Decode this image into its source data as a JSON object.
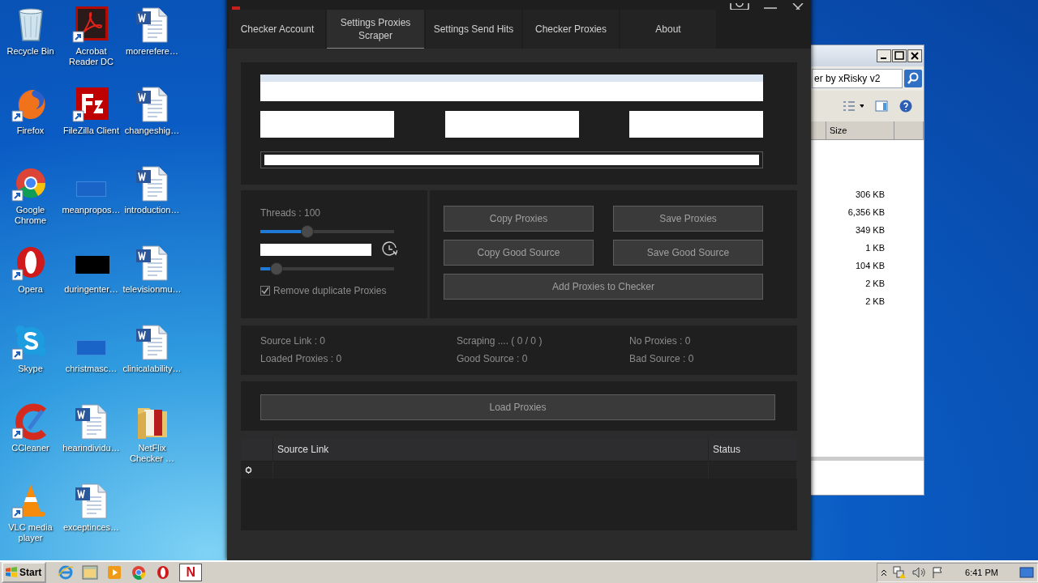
{
  "desktop": {
    "icons": [
      {
        "label": "Recycle Bin",
        "kind": "recycle",
        "shortcut": false
      },
      {
        "label": "Firefox",
        "kind": "firefox",
        "shortcut": true
      },
      {
        "label": "Google Chrome",
        "kind": "chrome",
        "shortcut": true
      },
      {
        "label": "Opera",
        "kind": "opera",
        "shortcut": true
      },
      {
        "label": "Skype",
        "kind": "skype",
        "shortcut": true
      },
      {
        "label": "CCleaner",
        "kind": "ccleaner",
        "shortcut": true
      },
      {
        "label": "VLC media player",
        "kind": "vlc",
        "shortcut": true
      },
      {
        "label": "Acrobat Reader DC",
        "kind": "acrobat",
        "shortcut": true
      },
      {
        "label": "FileZilla Client",
        "kind": "filezilla",
        "shortcut": true
      },
      {
        "label": "meanpropos…",
        "kind": "blank",
        "shortcut": false
      },
      {
        "label": "duringenter…",
        "kind": "black",
        "shortcut": false
      },
      {
        "label": "christmasc…",
        "kind": "blank",
        "shortcut": false
      },
      {
        "label": "hearindividu…",
        "kind": "word",
        "shortcut": false
      },
      {
        "label": "exceptinces…",
        "kind": "word",
        "shortcut": false
      },
      {
        "label": "morerefere…",
        "kind": "word",
        "shortcut": false
      },
      {
        "label": "changeshig…",
        "kind": "word",
        "shortcut": false
      },
      {
        "label": "introduction…",
        "kind": "word",
        "shortcut": false
      },
      {
        "label": "televisionmu…",
        "kind": "word",
        "shortcut": false
      },
      {
        "label": "clinicalability…",
        "kind": "word",
        "shortcut": false
      },
      {
        "label": "NetFlix Checker …",
        "kind": "folder",
        "shortcut": false
      }
    ]
  },
  "app": {
    "tabs": [
      {
        "label": "Checker Account",
        "selected": false
      },
      {
        "label": "Settings Proxies Scraper",
        "selected": true
      },
      {
        "label": "Settings Send Hits",
        "selected": false
      },
      {
        "label": "Checker Proxies",
        "selected": false
      },
      {
        "label": "About",
        "selected": false
      }
    ],
    "threads_label": "Threads : 100",
    "threads_slider": {
      "level": 0.35
    },
    "delay_slider": {
      "level": 0.12
    },
    "remove_duplicates": {
      "label": "Remove duplicate Proxies",
      "checked": true
    },
    "buttons": [
      "Copy Proxies",
      "Save Proxies",
      "Copy Good Source",
      "Save Good Source"
    ],
    "add_button": "Add Proxies to Checker",
    "stats": [
      "Source Link : 0",
      "Scraping .... ( 0 / 0 )",
      "No Proxies : 0",
      "Loaded Proxies : 0",
      "Good Source : 0",
      "Bad Source : 0"
    ],
    "load_button": "Load Proxies",
    "grid": {
      "columns": [
        "Source Link",
        "Status"
      ]
    }
  },
  "explorer": {
    "address": "er by xRisky v2",
    "column": "Size",
    "sizes": [
      "306 KB",
      "6,356 KB",
      "349 KB",
      "1 KB",
      "104 KB",
      "2 KB",
      "2 KB"
    ]
  },
  "taskbar": {
    "start": "Start",
    "apps": [
      {
        "kind": "ie"
      },
      {
        "kind": "folder"
      },
      {
        "kind": "media"
      },
      {
        "kind": "chrome"
      },
      {
        "kind": "opera"
      },
      {
        "kind": "netflix",
        "glyph": "N"
      }
    ],
    "clock": "6:41 PM"
  }
}
